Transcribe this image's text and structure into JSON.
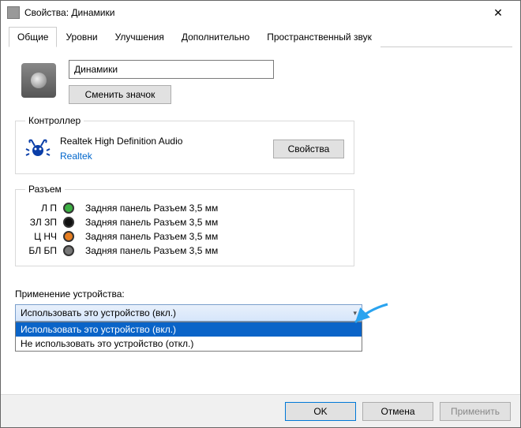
{
  "window": {
    "title": "Свойства: Динамики"
  },
  "tabs": [
    "Общие",
    "Уровни",
    "Улучшения",
    "Дополнительно",
    "Пространственный звук"
  ],
  "general": {
    "device_name": "Динамики",
    "change_icon_btn": "Сменить значок"
  },
  "controller": {
    "legend": "Контроллер",
    "name": "Realtek High Definition Audio",
    "vendor": "Realtek",
    "properties_btn": "Свойства"
  },
  "jacks": {
    "legend": "Разъем",
    "items": [
      {
        "label": "Л П",
        "color": "#3cb043",
        "desc": "Задняя панель Разъем 3,5 мм"
      },
      {
        "label": "ЗЛ ЗП",
        "color": "#111111",
        "desc": "Задняя панель Разъем 3,5 мм"
      },
      {
        "label": "Ц НЧ",
        "color": "#e67e22",
        "desc": "Задняя панель Разъем 3,5 мм"
      },
      {
        "label": "БЛ БП",
        "color": "#777777",
        "desc": "Задняя панель Разъем 3,5 мм"
      }
    ]
  },
  "usage": {
    "label": "Применение устройства:",
    "selected": "Использовать это устройство (вкл.)",
    "options": [
      "Использовать это устройство (вкл.)",
      "Не использовать это устройство (откл.)"
    ]
  },
  "footer": {
    "ok": "OK",
    "cancel": "Отмена",
    "apply": "Применить"
  },
  "colors": {
    "accent": "#0a64c8"
  }
}
